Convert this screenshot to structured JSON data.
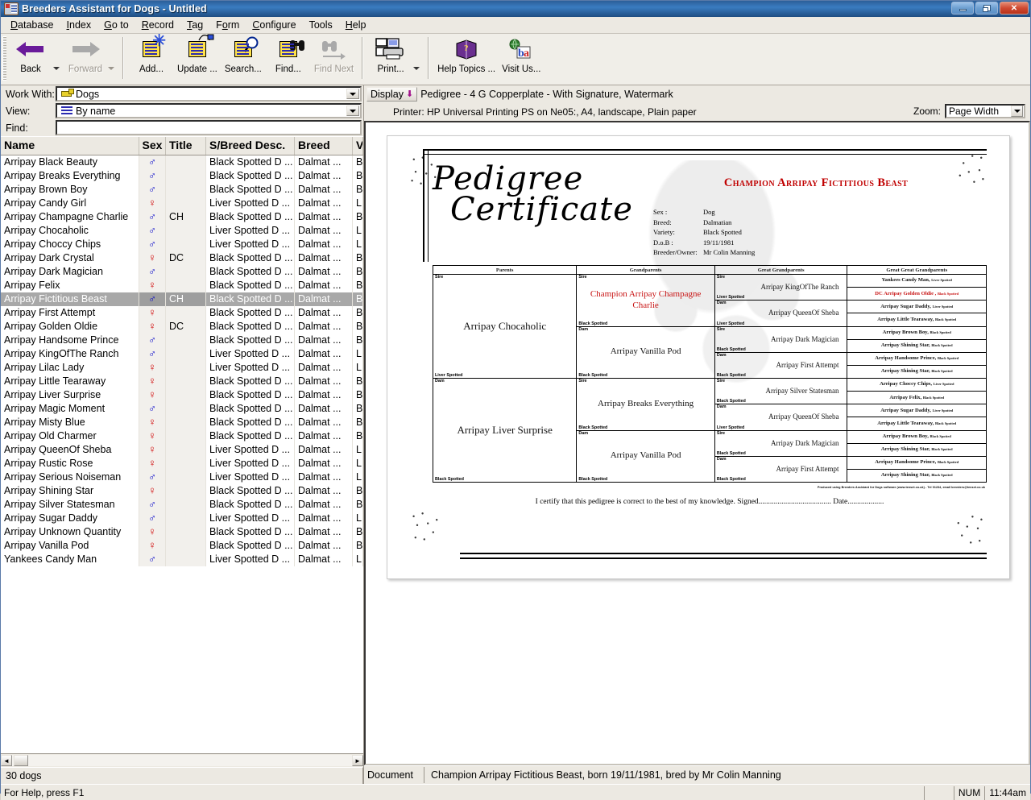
{
  "window": {
    "title": "Breeders Assistant for Dogs - Untitled",
    "minimize": "minimize-icon",
    "maximize": "restore-icon",
    "close": "✕"
  },
  "menu": [
    "Database",
    "Index",
    "Go to",
    "Record",
    "Tag",
    "Form",
    "Configure",
    "Tools",
    "Help"
  ],
  "toolbar": [
    {
      "label": "Back",
      "icon": "back-arrow-icon",
      "enabled": true,
      "dropdown": true
    },
    {
      "label": "Forward",
      "icon": "forward-arrow-icon",
      "enabled": false,
      "dropdown": true
    },
    {
      "label": "Add...",
      "icon": "add-record-icon",
      "enabled": true,
      "dropdown": false
    },
    {
      "label": "Update ...",
      "icon": "update-record-icon",
      "enabled": true,
      "dropdown": false
    },
    {
      "label": "Search...",
      "icon": "search-icon",
      "enabled": true,
      "dropdown": false
    },
    {
      "label": "Find...",
      "icon": "find-binoculars-icon",
      "enabled": true,
      "dropdown": false
    },
    {
      "label": "Find Next",
      "icon": "find-next-icon",
      "enabled": false,
      "dropdown": false
    },
    {
      "label": "Print...",
      "icon": "printer-icon",
      "enabled": true,
      "dropdown": true
    },
    {
      "label": "Help Topics ...",
      "icon": "help-book-icon",
      "enabled": true,
      "dropdown": false
    },
    {
      "label": "Visit Us...",
      "icon": "globe-icon",
      "enabled": true,
      "dropdown": false
    }
  ],
  "left_panel": {
    "work_with_label": "Work With:",
    "work_with_value": "Dogs",
    "view_label": "View:",
    "view_value": "By name",
    "find_label": "Find:",
    "find_value": "",
    "find_placeholder": "",
    "columns": [
      "Name",
      "Sex",
      "Title",
      "S/Breed Desc.",
      "Breed",
      "V"
    ],
    "rows": [
      {
        "name": "Arripay Black Beauty",
        "sex": "M",
        "title": "",
        "sbreed": "Black Spotted D ...",
        "breed": "Dalmat ...",
        "v": "B"
      },
      {
        "name": "Arripay Breaks Everything",
        "sex": "M",
        "title": "",
        "sbreed": "Black Spotted D ...",
        "breed": "Dalmat ...",
        "v": "B"
      },
      {
        "name": "Arripay Brown Boy",
        "sex": "M",
        "title": "",
        "sbreed": "Black Spotted D ...",
        "breed": "Dalmat ...",
        "v": "B"
      },
      {
        "name": "Arripay Candy Girl",
        "sex": "F",
        "title": "",
        "sbreed": "Liver Spotted D ...",
        "breed": "Dalmat ...",
        "v": "L"
      },
      {
        "name": "Arripay Champagne Charlie",
        "sex": "M",
        "title": "CH",
        "sbreed": "Black Spotted D ...",
        "breed": "Dalmat ...",
        "v": "B"
      },
      {
        "name": "Arripay Chocaholic",
        "sex": "M",
        "title": "",
        "sbreed": "Liver Spotted D ...",
        "breed": "Dalmat ...",
        "v": "L"
      },
      {
        "name": "Arripay Choccy Chips",
        "sex": "M",
        "title": "",
        "sbreed": "Liver Spotted D ...",
        "breed": "Dalmat ...",
        "v": "L"
      },
      {
        "name": "Arripay Dark Crystal",
        "sex": "F",
        "title": "DC",
        "sbreed": "Black Spotted D ...",
        "breed": "Dalmat ...",
        "v": "B"
      },
      {
        "name": "Arripay Dark Magician",
        "sex": "M",
        "title": "",
        "sbreed": "Black Spotted D ...",
        "breed": "Dalmat ...",
        "v": "B"
      },
      {
        "name": "Arripay Felix",
        "sex": "F",
        "title": "",
        "sbreed": "Black Spotted D ...",
        "breed": "Dalmat ...",
        "v": "B"
      },
      {
        "name": "Arripay Fictitious Beast",
        "sex": "M",
        "title": "CH",
        "sbreed": "Black Spotted D ...",
        "breed": "Dalmat ...",
        "v": "B",
        "selected": true
      },
      {
        "name": "Arripay First Attempt",
        "sex": "F",
        "title": "",
        "sbreed": "Black Spotted D ...",
        "breed": "Dalmat ...",
        "v": "B"
      },
      {
        "name": "Arripay Golden Oldie",
        "sex": "F",
        "title": "DC",
        "sbreed": "Black Spotted D ...",
        "breed": "Dalmat ...",
        "v": "B"
      },
      {
        "name": "Arripay Handsome Prince",
        "sex": "M",
        "title": "",
        "sbreed": "Black Spotted D ...",
        "breed": "Dalmat ...",
        "v": "B"
      },
      {
        "name": "Arripay KingOfThe Ranch",
        "sex": "M",
        "title": "",
        "sbreed": "Liver Spotted D ...",
        "breed": "Dalmat ...",
        "v": "L"
      },
      {
        "name": "Arripay Lilac Lady",
        "sex": "F",
        "title": "",
        "sbreed": "Liver Spotted D ...",
        "breed": "Dalmat ...",
        "v": "L"
      },
      {
        "name": "Arripay Little Tearaway",
        "sex": "F",
        "title": "",
        "sbreed": "Black Spotted D ...",
        "breed": "Dalmat ...",
        "v": "B"
      },
      {
        "name": "Arripay Liver Surprise",
        "sex": "F",
        "title": "",
        "sbreed": "Black Spotted D ...",
        "breed": "Dalmat ...",
        "v": "B"
      },
      {
        "name": "Arripay Magic Moment",
        "sex": "M",
        "title": "",
        "sbreed": "Black Spotted D ...",
        "breed": "Dalmat ...",
        "v": "B"
      },
      {
        "name": "Arripay Misty Blue",
        "sex": "F",
        "title": "",
        "sbreed": "Black Spotted D ...",
        "breed": "Dalmat ...",
        "v": "B"
      },
      {
        "name": "Arripay Old Charmer",
        "sex": "F",
        "title": "",
        "sbreed": "Black Spotted D ...",
        "breed": "Dalmat ...",
        "v": "B"
      },
      {
        "name": "Arripay QueenOf Sheba",
        "sex": "F",
        "title": "",
        "sbreed": "Liver Spotted D ...",
        "breed": "Dalmat ...",
        "v": "L"
      },
      {
        "name": "Arripay Rustic Rose",
        "sex": "F",
        "title": "",
        "sbreed": "Liver Spotted D ...",
        "breed": "Dalmat ...",
        "v": "L"
      },
      {
        "name": "Arripay Serious Noiseman",
        "sex": "M",
        "title": "",
        "sbreed": "Liver Spotted D ...",
        "breed": "Dalmat ...",
        "v": "L"
      },
      {
        "name": "Arripay Shining Star",
        "sex": "F",
        "title": "",
        "sbreed": "Black Spotted D ...",
        "breed": "Dalmat ...",
        "v": "B"
      },
      {
        "name": "Arripay Silver Statesman",
        "sex": "M",
        "title": "",
        "sbreed": "Black Spotted D ...",
        "breed": "Dalmat ...",
        "v": "B"
      },
      {
        "name": "Arripay Sugar Daddy",
        "sex": "M",
        "title": "",
        "sbreed": "Liver Spotted D ...",
        "breed": "Dalmat ...",
        "v": "L"
      },
      {
        "name": "Arripay Unknown Quantity",
        "sex": "F",
        "title": "",
        "sbreed": "Black Spotted D ...",
        "breed": "Dalmat ...",
        "v": "B"
      },
      {
        "name": "Arripay Vanilla Pod",
        "sex": "F",
        "title": "",
        "sbreed": "Black Spotted D ...",
        "breed": "Dalmat ...",
        "v": "B"
      },
      {
        "name": "Yankees Candy Man",
        "sex": "M",
        "title": "",
        "sbreed": "Liver Spotted D ...",
        "breed": "Dalmat ...",
        "v": "L"
      }
    ],
    "status": "30 dogs"
  },
  "right_panel": {
    "display_button": "Display",
    "form_title": "Pedigree - 4 G Copperplate - With Signature, Watermark",
    "printer_line": "Printer: HP Universal Printing PS on Ne05:, A4, landscape, Plain paper",
    "zoom_label": "Zoom:",
    "zoom_value": "Page Width",
    "doc_label": "Document",
    "doc_status": "Champion Arripay Fictitious Beast, born 19/11/1981, bred by Mr Colin Manning"
  },
  "certificate": {
    "title_line1": "Pedigree",
    "title_line2": "Certificate",
    "dog_title": "Champion Arripay Fictitious Beast",
    "details": [
      {
        "key": "Sex :",
        "value": "Dog"
      },
      {
        "key": "Breed:",
        "value": "Dalmatian"
      },
      {
        "key": "Variety:",
        "value": "Black Spotted"
      },
      {
        "key": "D.o.B :",
        "value": "19/11/1981"
      },
      {
        "key": "Breeder/Owner:",
        "value": "Mr Colin Manning"
      }
    ],
    "column_headers": [
      "Parents",
      "Grandparents",
      "Great Grandparents",
      "Great Great Grandparents"
    ],
    "parents": [
      {
        "tag": "Sire",
        "name": "Arripay Chocaholic",
        "variety": "Liver Spotted",
        "red": false
      },
      {
        "tag": "Dam",
        "name": "Arripay Liver Surprise",
        "variety": "Black Spotted",
        "red": false
      }
    ],
    "grandparents": [
      {
        "tag": "Sire",
        "name": "Champion Arripay Champagne Charlie",
        "variety": "Black Spotted",
        "red": true
      },
      {
        "tag": "Dam",
        "name": "Arripay Vanilla Pod",
        "variety": "Black Spotted",
        "red": false
      },
      {
        "tag": "Sire",
        "name": "Arripay Breaks Everything",
        "variety": "Black Spotted",
        "red": false
      },
      {
        "tag": "Dam",
        "name": "Arripay Vanilla Pod",
        "variety": "Black Spotted",
        "red": false
      }
    ],
    "great_grandparents": [
      {
        "tag": "Sire",
        "name": "Arripay KingOfThe Ranch",
        "variety": "Liver Spotted",
        "red": false
      },
      {
        "tag": "Dam",
        "name": "Arripay QueenOf Sheba",
        "variety": "Liver Spotted",
        "red": false
      },
      {
        "tag": "Sire",
        "name": "Arripay Dark Magician",
        "variety": "Black Spotted",
        "red": false
      },
      {
        "tag": "Dam",
        "name": "Arripay First Attempt",
        "variety": "Black Spotted",
        "red": false
      },
      {
        "tag": "Sire",
        "name": "Arripay Silver Statesman",
        "variety": "Black Spotted",
        "red": false
      },
      {
        "tag": "Dam",
        "name": "Arripay QueenOf Sheba",
        "variety": "Liver Spotted",
        "red": false
      },
      {
        "tag": "Sire",
        "name": "Arripay Dark Magician",
        "variety": "Black Spotted",
        "red": false
      },
      {
        "tag": "Dam",
        "name": "Arripay First Attempt",
        "variety": "Black Spotted",
        "red": false
      }
    ],
    "great_great_grandparents": [
      {
        "name": "Yankees Candy Man,",
        "variety": "Liver Spotted",
        "red": false
      },
      {
        "name": "DC Arripay Golden Oldie ,",
        "variety": "Black Spotted",
        "red": true
      },
      {
        "name": "Arripay Sugar Daddy,",
        "variety": "Liver Spotted",
        "red": false
      },
      {
        "name": "Arripay Little Tearaway,",
        "variety": "Black Spotted",
        "red": false
      },
      {
        "name": "Arripay Brown Boy,",
        "variety": "Black Spotted",
        "red": false
      },
      {
        "name": "Arripay Shining Star,",
        "variety": "Black Spotted",
        "red": false
      },
      {
        "name": "Arripay Handsome Prince,",
        "variety": "Black Spotted",
        "red": false
      },
      {
        "name": "Arripay Shining Star,",
        "variety": "Black Spotted",
        "red": false
      },
      {
        "name": "Arripay Choccy Chips,",
        "variety": "Liver Spotted",
        "red": false
      },
      {
        "name": "Arripay Felix,",
        "variety": "Black Spotted",
        "red": false
      },
      {
        "name": "Arripay Sugar Daddy,",
        "variety": "Liver Spotted",
        "red": false
      },
      {
        "name": "Arripay Little Tearaway,",
        "variety": "Black Spotted",
        "red": false
      },
      {
        "name": "Arripay Brown Boy,",
        "variety": "Black Spotted",
        "red": false
      },
      {
        "name": "Arripay Shining Star,",
        "variety": "Black Spotted",
        "red": false
      },
      {
        "name": "Arripay Handsome Prince,",
        "variety": "Black Spotted",
        "red": false
      },
      {
        "name": "Arripay Shining Star,",
        "variety": "Black Spotted",
        "red": false
      }
    ],
    "credit": "Produced using Breeders Assistant for Dogs software (www.tenset.co.uk) - Tel 01234, email breeders@tenset.co.uk",
    "certify": "I certify that this pedigree is correct to the best of my knowledge.  Signed...................................... Date..................."
  },
  "statusbar": {
    "help_text": "For Help, press F1",
    "num": "NUM",
    "time": "11:44am"
  },
  "colors": {
    "accent_red": "#c00000",
    "male": "#0000c8",
    "female": "#d00000",
    "selection": "#a8a8a8"
  }
}
